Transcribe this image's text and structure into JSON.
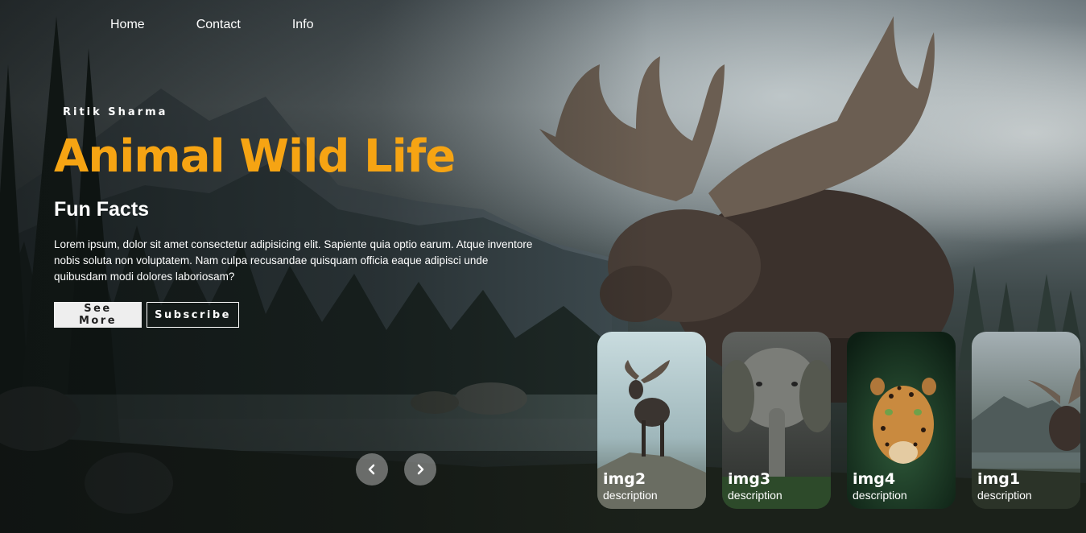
{
  "nav": {
    "items": [
      {
        "label": "Home"
      },
      {
        "label": "Contact"
      },
      {
        "label": "Info"
      }
    ]
  },
  "hero": {
    "author": "Ritik Sharma",
    "title": "Animal Wild Life",
    "subtitle": "Fun Facts",
    "description": "Lorem ipsum, dolor sit amet consectetur adipisicing elit. Sapiente quia optio earum. Atque inventore nobis soluta non voluptatem. Nam culpa recusandae quisquam officia eaque adipisci unde quibusdam modi dolores laboriosam?",
    "primary_button": "See More",
    "secondary_button": "Subscribe"
  },
  "carousel": {
    "prev_icon": "chevron-left-icon",
    "next_icon": "chevron-right-icon",
    "items": [
      {
        "name": "img2",
        "description": "description",
        "subject": "moose"
      },
      {
        "name": "img3",
        "description": "description",
        "subject": "elephant"
      },
      {
        "name": "img4",
        "description": "description",
        "subject": "leopard"
      },
      {
        "name": "img1",
        "description": "description",
        "subject": "moose"
      }
    ]
  },
  "colors": {
    "accent": "#f6a413",
    "text": "#ffffff",
    "button_light": "#eeeeee"
  }
}
